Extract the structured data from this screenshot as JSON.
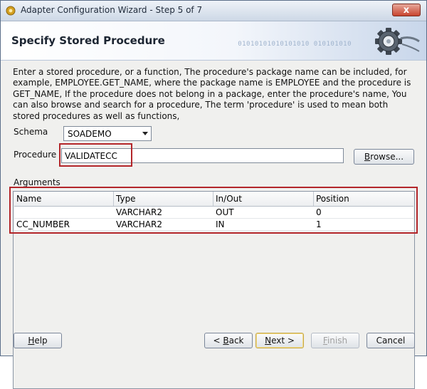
{
  "window": {
    "title": "Adapter Configuration Wizard - Step 5 of 7",
    "close_label": "x"
  },
  "header": {
    "title": "Specify Stored Procedure",
    "decor_binary": "01010101010101010 010101010"
  },
  "description": "Enter a stored procedure, or a function, The procedure's package name can be included, for example, EMPLOYEE.GET_NAME, where the package name is EMPLOYEE and the procedure is GET_NAME, If the procedure does not belong in a package, enter the procedure's name, You can also browse and search for a procedure, The term 'procedure' is used to mean both stored procedures as well as functions,",
  "form": {
    "schema_label": "Schema",
    "schema_value": "SOADEMO",
    "procedure_label": "Procedure",
    "procedure_value": "VALIDATECC",
    "browse_label_mnemonic": "B",
    "browse_label_rest": "rowse..."
  },
  "arguments": {
    "label": "Arguments",
    "columns": [
      "Name",
      "Type",
      "In/Out",
      "Position"
    ],
    "rows": [
      {
        "name": "",
        "type": "VARCHAR2",
        "inout": "OUT",
        "position": "0"
      },
      {
        "name": "CC_NUMBER",
        "type": "VARCHAR2",
        "inout": "IN",
        "position": "1"
      }
    ]
  },
  "footer": {
    "help_mnemonic": "H",
    "help_rest": "elp",
    "back_prefix": "< ",
    "back_mnemonic": "B",
    "back_rest": "ack",
    "next_mnemonic": "N",
    "next_rest": "ext >",
    "finish_mnemonic": "F",
    "finish_rest": "inish",
    "cancel_label": "Cancel"
  },
  "colors": {
    "highlight": "#b3262a",
    "window_bg": "#f0f0ee",
    "titlebar_close": "#c8442e"
  }
}
